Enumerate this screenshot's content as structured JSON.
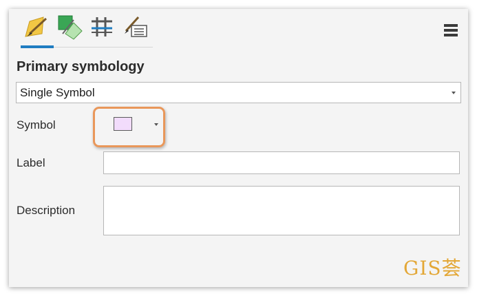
{
  "toolbar": {
    "tabs": [
      {
        "icon": "paintbrush-icon",
        "selected": true
      },
      {
        "icon": "vary-symbology-icon",
        "selected": false
      },
      {
        "icon": "symbol-layer-drawing-icon",
        "selected": false
      },
      {
        "icon": "advanced-symbology-options-icon",
        "selected": false
      }
    ],
    "menu_icon": "hamburger-menu-icon"
  },
  "section": {
    "title": "Primary symbology",
    "selected_value": "Single Symbol"
  },
  "fields": {
    "symbol_label": "Symbol",
    "symbol_color": "#f2dcfc",
    "label_label": "Label",
    "label_value": "",
    "description_label": "Description",
    "description_value": ""
  },
  "watermark": "GIS荟",
  "colors": {
    "accent": "#1f7dc1",
    "highlight": "#e9975a",
    "watermark": "#e3a736"
  }
}
